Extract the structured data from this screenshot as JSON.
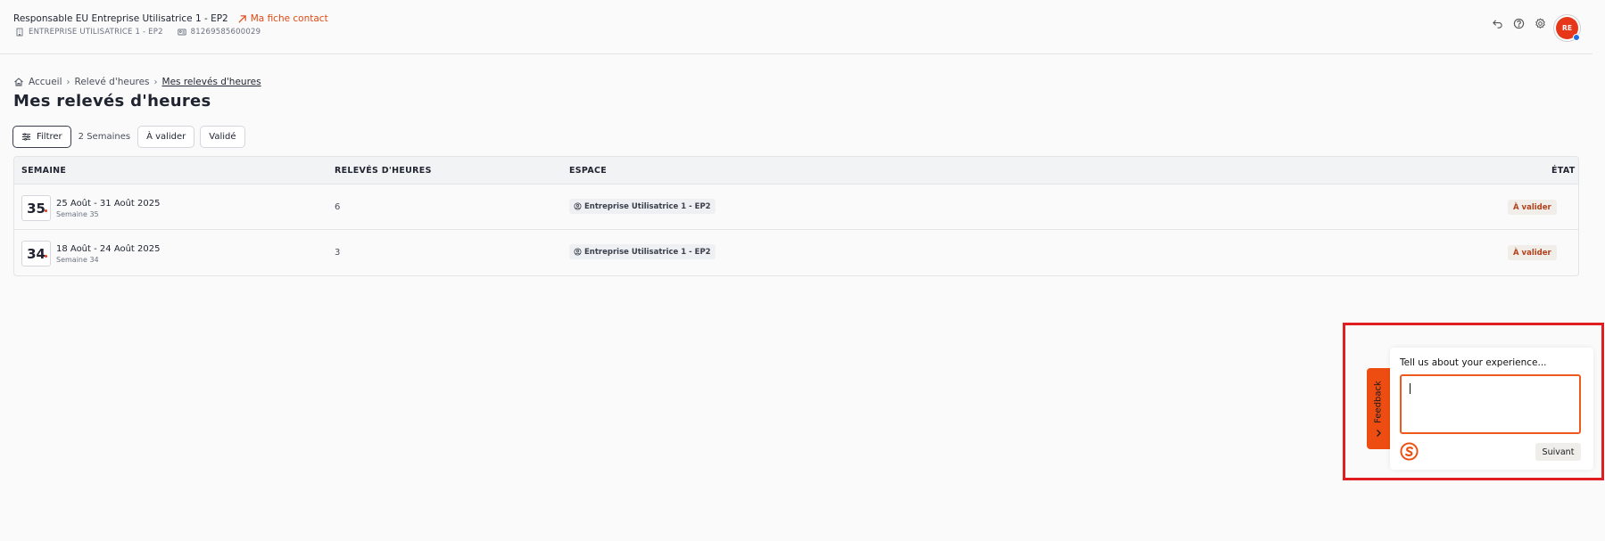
{
  "header": {
    "user_title": "Responsable EU Entreprise Utilisatrice 1 - EP2",
    "contact_link": "Ma fiche contact",
    "company": "ENTREPRISE UTILISATRICE 1 - EP2",
    "siret": "81269585600029",
    "avatar_initials": "RE",
    "icons": [
      "undo-icon",
      "help-icon",
      "settings-icon"
    ]
  },
  "breadcrumb": {
    "home": "Accueil",
    "parent": "Relevé d'heures",
    "current": "Mes relevés d'heures"
  },
  "page_title": "Mes relevés d'heures",
  "filters": {
    "filter_label": "Filtrer",
    "count_label": "2 Semaines",
    "chips": [
      "À valider",
      "Validé"
    ]
  },
  "table": {
    "columns": [
      "SEMAINE",
      "RELEVÉS D'HEURES",
      "ESPACE",
      "ÉTAT"
    ],
    "rows": [
      {
        "week_number": "35",
        "range": "25 Août - 31 Août 2025",
        "week_label": "Semaine 35",
        "count": "6",
        "space": "Entreprise Utilisatrice 1 - EP2",
        "state": "À valider"
      },
      {
        "week_number": "34",
        "range": "18 Août - 24 Août 2025",
        "week_label": "Semaine 34",
        "count": "3",
        "space": "Entreprise Utilisatrice 1 - EP2",
        "state": "À valider"
      }
    ]
  },
  "feedback": {
    "tab_label": "Feedback",
    "question": "Tell us about your experience...",
    "input_value": "",
    "next_label": "Suivant"
  },
  "colors": {
    "accent": "#ee4d12",
    "highlight": "#e01e22",
    "state_text": "#b2401a",
    "avatar": "#e6371b"
  }
}
